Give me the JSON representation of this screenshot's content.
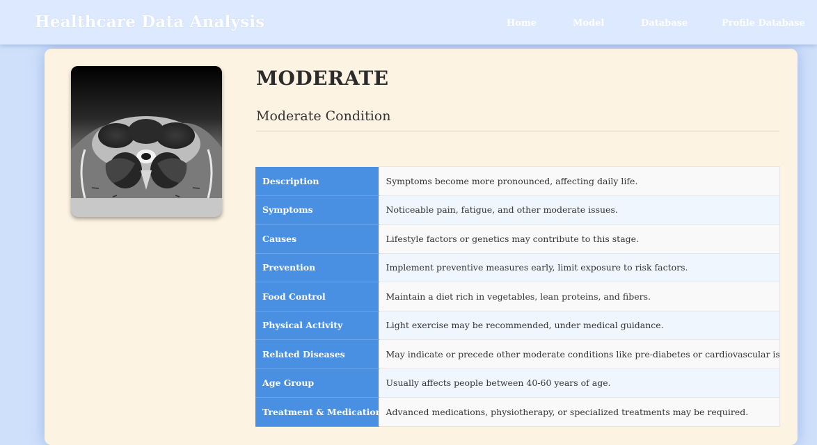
{
  "navbar": {
    "brand": "Healthcare Data Analysis",
    "links": [
      {
        "label": "Home"
      },
      {
        "label": "Model"
      },
      {
        "label": "Database"
      },
      {
        "label": "Profile Database"
      }
    ]
  },
  "condition": {
    "level": "MODERATE",
    "subtitle": "Moderate Condition"
  },
  "details": [
    {
      "key": "Description",
      "value": "Symptoms become more pronounced, affecting daily life."
    },
    {
      "key": "Symptoms",
      "value": "Noticeable pain, fatigue, and other moderate issues."
    },
    {
      "key": "Causes",
      "value": "Lifestyle factors or genetics may contribute to this stage."
    },
    {
      "key": "Prevention",
      "value": "Implement preventive measures early, limit exposure to risk factors."
    },
    {
      "key": "Food Control",
      "value": "Maintain a diet rich in vegetables, lean proteins, and fibers."
    },
    {
      "key": "Physical Activity",
      "value": "Light exercise may be recommended, under medical guidance."
    },
    {
      "key": "Related Diseases",
      "value": "May indicate or precede other moderate conditions like pre-diabetes or cardiovascular issues."
    },
    {
      "key": "Age Group",
      "value": "Usually affects people between 40-60 years of age."
    },
    {
      "key": "Treatment & Medication",
      "value": "Advanced medications, physiotherapy, or specialized treatments may be required."
    }
  ],
  "colors": {
    "navbar_bg": "#dce9ff",
    "page_bg": "#cfe0fb",
    "card_bg": "#fdf3e3",
    "table_key_bg": "#4a90e2"
  }
}
